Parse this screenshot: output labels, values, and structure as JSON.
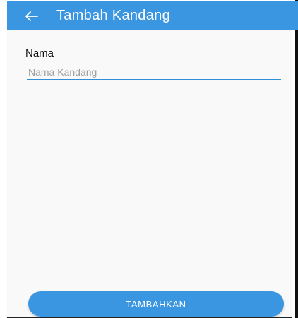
{
  "app_bar": {
    "back_icon": "arrow-left-icon",
    "title": "Tambah Kandang",
    "color": "#3a96e0"
  },
  "form": {
    "name_label": "Nama",
    "name_placeholder": "Nama Kandang",
    "name_value": ""
  },
  "actions": {
    "submit_label": "TAMBAHKAN"
  }
}
